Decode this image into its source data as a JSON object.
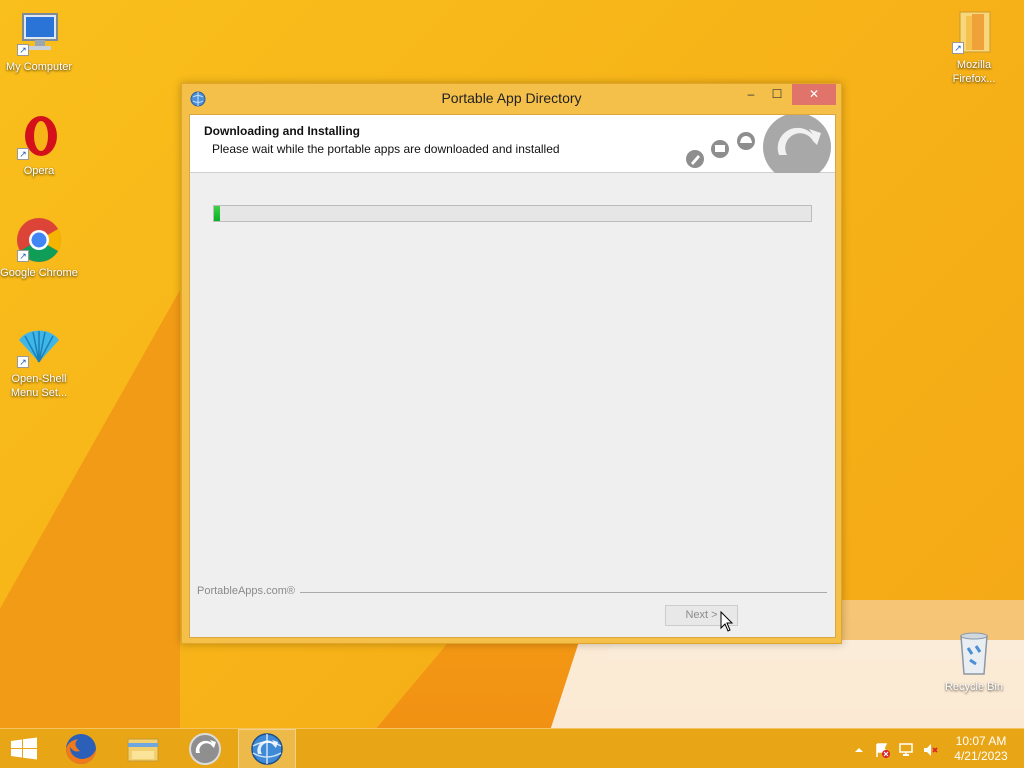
{
  "desktop": {
    "icons": [
      {
        "label": "My Computer"
      },
      {
        "label": "Opera"
      },
      {
        "label": "Google Chrome"
      },
      {
        "label": "Open-Shell Menu Set..."
      },
      {
        "label": "Mozilla Firefox..."
      },
      {
        "label": "Recycle Bin"
      }
    ]
  },
  "window": {
    "title": "Portable App Directory",
    "minimize": "–",
    "maximize": "☐",
    "close": "✕",
    "header": {
      "title": "Downloading and Installing",
      "subtitle": "Please wait while the portable apps are downloaded and installed"
    },
    "progress_fraction": 0.01,
    "brand": "PortableApps.com®",
    "next_button": "Next >"
  },
  "taskbar": {
    "apps": [
      {
        "icon": "firefox-icon"
      },
      {
        "icon": "file-explorer-icon"
      },
      {
        "icon": "portableapps-icon"
      },
      {
        "icon": "portable-app-directory-icon",
        "active": true
      }
    ],
    "clock": {
      "time": "10:07 AM",
      "date": "4/21/2023"
    }
  },
  "colors": {
    "wallpaper": "#f7b418",
    "taskbar": "#e8a617",
    "window_frame": "#f5c04a",
    "close_button": "#e0736a",
    "progress_fill": "#06b025"
  }
}
